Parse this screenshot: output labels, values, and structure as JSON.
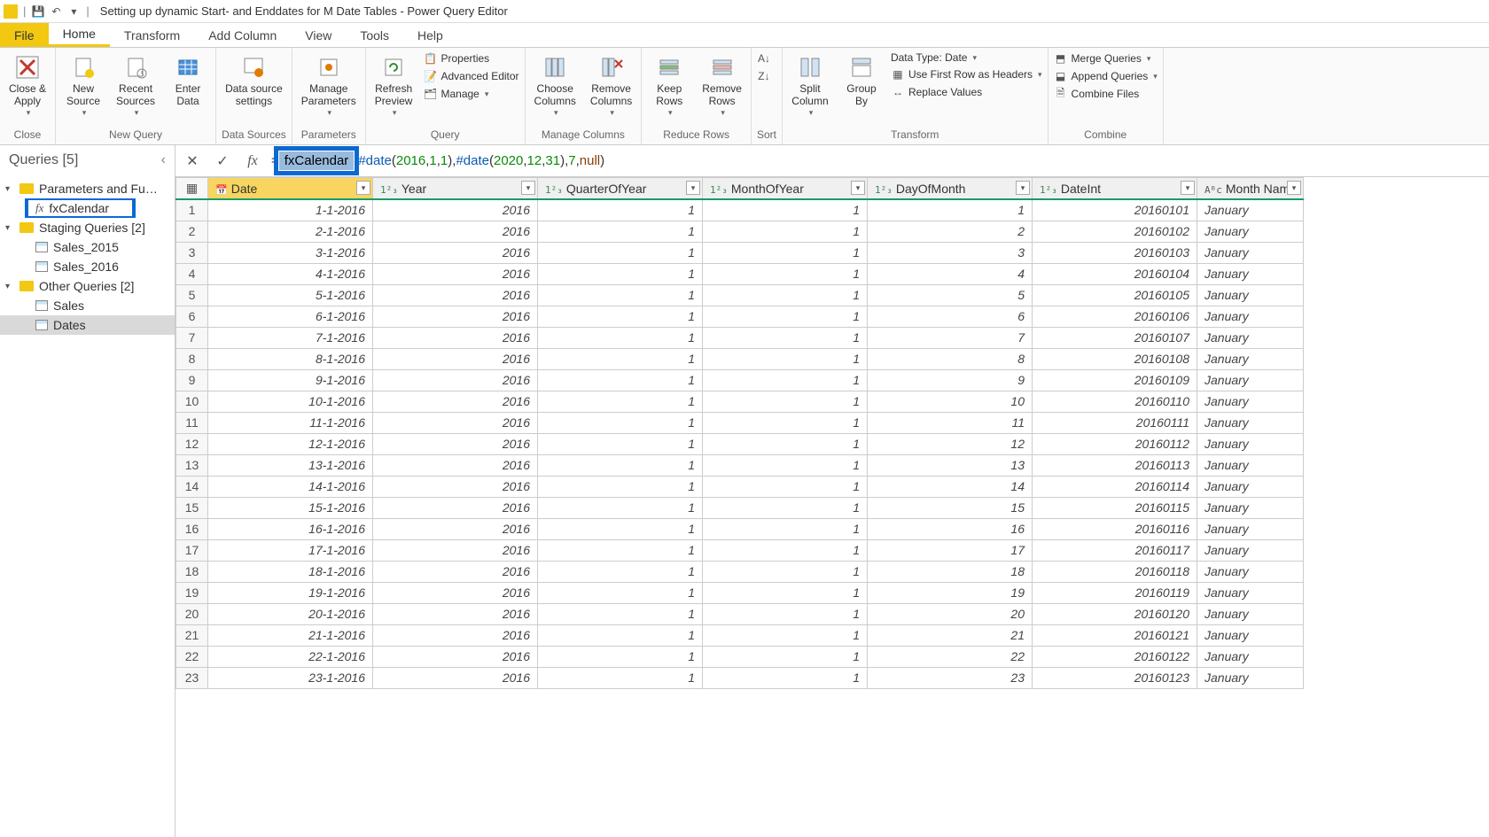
{
  "title": "Setting up dynamic Start- and Enddates for M Date Tables - Power Query Editor",
  "qat": {
    "save": "save-icon",
    "undo": "undo-icon"
  },
  "menu": {
    "file": "File",
    "home": "Home",
    "transform": "Transform",
    "addcol": "Add Column",
    "view": "View",
    "tools": "Tools",
    "help": "Help"
  },
  "ribbon": {
    "close": {
      "closeApply": "Close &\nApply",
      "group": "Close"
    },
    "newquery": {
      "newSource": "New\nSource",
      "recentSources": "Recent\nSources",
      "enterData": "Enter\nData",
      "group": "New Query"
    },
    "datasources": {
      "settings": "Data source\nsettings",
      "group": "Data Sources"
    },
    "parameters": {
      "manage": "Manage\nParameters",
      "group": "Parameters"
    },
    "query": {
      "refresh": "Refresh\nPreview",
      "properties": "Properties",
      "advEditor": "Advanced Editor",
      "manage": "Manage",
      "group": "Query"
    },
    "manageCols": {
      "choose": "Choose\nColumns",
      "remove": "Remove\nColumns",
      "group": "Manage Columns"
    },
    "reduce": {
      "keep": "Keep\nRows",
      "remove": "Remove\nRows",
      "group": "Reduce Rows"
    },
    "sort": {
      "group": "Sort"
    },
    "transform": {
      "split": "Split\nColumn",
      "groupBy": "Group\nBy",
      "dataType": "Data Type: Date",
      "firstRow": "Use First Row as Headers",
      "replace": "Replace Values",
      "group": "Transform"
    },
    "combine": {
      "merge": "Merge Queries",
      "append": "Append Queries",
      "combineFiles": "Combine Files",
      "group": "Combine"
    }
  },
  "queries": {
    "header": "Queries [5]",
    "groups": [
      {
        "name": "Parameters and Fu…",
        "items": [
          {
            "name": "fxCalendar",
            "kind": "fx",
            "highlight": true
          }
        ]
      },
      {
        "name": "Staging Queries [2]",
        "items": [
          {
            "name": "Sales_2015",
            "kind": "table"
          },
          {
            "name": "Sales_2016",
            "kind": "table"
          }
        ]
      },
      {
        "name": "Other Queries [2]",
        "items": [
          {
            "name": "Sales",
            "kind": "table"
          },
          {
            "name": "Dates",
            "kind": "table",
            "selected": true
          }
        ]
      }
    ]
  },
  "formula": {
    "fnName": "fxCalendar",
    "paren": "(",
    "kw1": "#date",
    "p1a": "2016",
    "p1b": "1",
    "p1c": "1",
    "sep": ", ",
    "kw2": "#date",
    "p2a": "2020",
    "p2b": "12",
    "p2c": "31",
    "p3": "7",
    "p4": "null",
    "close": ")"
  },
  "columns": [
    {
      "key": "Date",
      "label": "Date",
      "type": "date"
    },
    {
      "key": "Year",
      "label": "Year",
      "type": "num"
    },
    {
      "key": "QuarterOfYear",
      "label": "QuarterOfYear",
      "type": "num"
    },
    {
      "key": "MonthOfYear",
      "label": "MonthOfYear",
      "type": "num"
    },
    {
      "key": "DayOfMonth",
      "label": "DayOfMonth",
      "type": "num"
    },
    {
      "key": "DateInt",
      "label": "DateInt",
      "type": "num"
    },
    {
      "key": "MonthName",
      "label": "Month Nam",
      "type": "text"
    }
  ],
  "rows": [
    {
      "n": 1,
      "Date": "1-1-2016",
      "Year": "2016",
      "QuarterOfYear": "1",
      "MonthOfYear": "1",
      "DayOfMonth": "1",
      "DateInt": "20160101",
      "MonthName": "January"
    },
    {
      "n": 2,
      "Date": "2-1-2016",
      "Year": "2016",
      "QuarterOfYear": "1",
      "MonthOfYear": "1",
      "DayOfMonth": "2",
      "DateInt": "20160102",
      "MonthName": "January"
    },
    {
      "n": 3,
      "Date": "3-1-2016",
      "Year": "2016",
      "QuarterOfYear": "1",
      "MonthOfYear": "1",
      "DayOfMonth": "3",
      "DateInt": "20160103",
      "MonthName": "January"
    },
    {
      "n": 4,
      "Date": "4-1-2016",
      "Year": "2016",
      "QuarterOfYear": "1",
      "MonthOfYear": "1",
      "DayOfMonth": "4",
      "DateInt": "20160104",
      "MonthName": "January"
    },
    {
      "n": 5,
      "Date": "5-1-2016",
      "Year": "2016",
      "QuarterOfYear": "1",
      "MonthOfYear": "1",
      "DayOfMonth": "5",
      "DateInt": "20160105",
      "MonthName": "January"
    },
    {
      "n": 6,
      "Date": "6-1-2016",
      "Year": "2016",
      "QuarterOfYear": "1",
      "MonthOfYear": "1",
      "DayOfMonth": "6",
      "DateInt": "20160106",
      "MonthName": "January"
    },
    {
      "n": 7,
      "Date": "7-1-2016",
      "Year": "2016",
      "QuarterOfYear": "1",
      "MonthOfYear": "1",
      "DayOfMonth": "7",
      "DateInt": "20160107",
      "MonthName": "January"
    },
    {
      "n": 8,
      "Date": "8-1-2016",
      "Year": "2016",
      "QuarterOfYear": "1",
      "MonthOfYear": "1",
      "DayOfMonth": "8",
      "DateInt": "20160108",
      "MonthName": "January"
    },
    {
      "n": 9,
      "Date": "9-1-2016",
      "Year": "2016",
      "QuarterOfYear": "1",
      "MonthOfYear": "1",
      "DayOfMonth": "9",
      "DateInt": "20160109",
      "MonthName": "January"
    },
    {
      "n": 10,
      "Date": "10-1-2016",
      "Year": "2016",
      "QuarterOfYear": "1",
      "MonthOfYear": "1",
      "DayOfMonth": "10",
      "DateInt": "20160110",
      "MonthName": "January"
    },
    {
      "n": 11,
      "Date": "11-1-2016",
      "Year": "2016",
      "QuarterOfYear": "1",
      "MonthOfYear": "1",
      "DayOfMonth": "11",
      "DateInt": "20160111",
      "MonthName": "January"
    },
    {
      "n": 12,
      "Date": "12-1-2016",
      "Year": "2016",
      "QuarterOfYear": "1",
      "MonthOfYear": "1",
      "DayOfMonth": "12",
      "DateInt": "20160112",
      "MonthName": "January"
    },
    {
      "n": 13,
      "Date": "13-1-2016",
      "Year": "2016",
      "QuarterOfYear": "1",
      "MonthOfYear": "1",
      "DayOfMonth": "13",
      "DateInt": "20160113",
      "MonthName": "January"
    },
    {
      "n": 14,
      "Date": "14-1-2016",
      "Year": "2016",
      "QuarterOfYear": "1",
      "MonthOfYear": "1",
      "DayOfMonth": "14",
      "DateInt": "20160114",
      "MonthName": "January"
    },
    {
      "n": 15,
      "Date": "15-1-2016",
      "Year": "2016",
      "QuarterOfYear": "1",
      "MonthOfYear": "1",
      "DayOfMonth": "15",
      "DateInt": "20160115",
      "MonthName": "January"
    },
    {
      "n": 16,
      "Date": "16-1-2016",
      "Year": "2016",
      "QuarterOfYear": "1",
      "MonthOfYear": "1",
      "DayOfMonth": "16",
      "DateInt": "20160116",
      "MonthName": "January"
    },
    {
      "n": 17,
      "Date": "17-1-2016",
      "Year": "2016",
      "QuarterOfYear": "1",
      "MonthOfYear": "1",
      "DayOfMonth": "17",
      "DateInt": "20160117",
      "MonthName": "January"
    },
    {
      "n": 18,
      "Date": "18-1-2016",
      "Year": "2016",
      "QuarterOfYear": "1",
      "MonthOfYear": "1",
      "DayOfMonth": "18",
      "DateInt": "20160118",
      "MonthName": "January"
    },
    {
      "n": 19,
      "Date": "19-1-2016",
      "Year": "2016",
      "QuarterOfYear": "1",
      "MonthOfYear": "1",
      "DayOfMonth": "19",
      "DateInt": "20160119",
      "MonthName": "January"
    },
    {
      "n": 20,
      "Date": "20-1-2016",
      "Year": "2016",
      "QuarterOfYear": "1",
      "MonthOfYear": "1",
      "DayOfMonth": "20",
      "DateInt": "20160120",
      "MonthName": "January"
    },
    {
      "n": 21,
      "Date": "21-1-2016",
      "Year": "2016",
      "QuarterOfYear": "1",
      "MonthOfYear": "1",
      "DayOfMonth": "21",
      "DateInt": "20160121",
      "MonthName": "January"
    },
    {
      "n": 22,
      "Date": "22-1-2016",
      "Year": "2016",
      "QuarterOfYear": "1",
      "MonthOfYear": "1",
      "DayOfMonth": "22",
      "DateInt": "20160122",
      "MonthName": "January"
    },
    {
      "n": 23,
      "Date": "23-1-2016",
      "Year": "2016",
      "QuarterOfYear": "1",
      "MonthOfYear": "1",
      "DayOfMonth": "23",
      "DateInt": "20160123",
      "MonthName": "January"
    }
  ]
}
